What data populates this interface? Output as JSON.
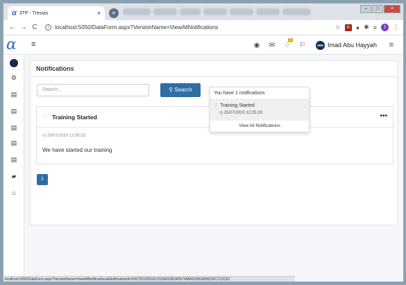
{
  "browser": {
    "tab_title": "3TP - Tresias",
    "url": "localhost:5050/DataForm.aspx?VersionName=ViewAllNotifications",
    "status_url": "localhost:5050/DataForm.aspx?VersionName=ViewAllNotifications&NotificationId=20072512053317620EFD6D4D57498AD3961808CDFC712C52"
  },
  "topnav": {
    "user_name": "Imad Abu Hayyah",
    "notification_count": "1"
  },
  "page": {
    "title": "Notifications",
    "search_placeholder": "Search...",
    "search_label": "Search"
  },
  "notification": {
    "title": "Training Started",
    "date": "25/07/2020 12:05:33",
    "body": "We have started our training"
  },
  "pagination": {
    "current": "1"
  },
  "dropdown": {
    "header": "You have 1 notifications",
    "item_title": "Training Started",
    "item_date": "25/07/2020 12:05:33",
    "footer": "View All Notifications"
  },
  "colors": {
    "primary": "#2f6ea5",
    "bell": "#f0a500"
  }
}
